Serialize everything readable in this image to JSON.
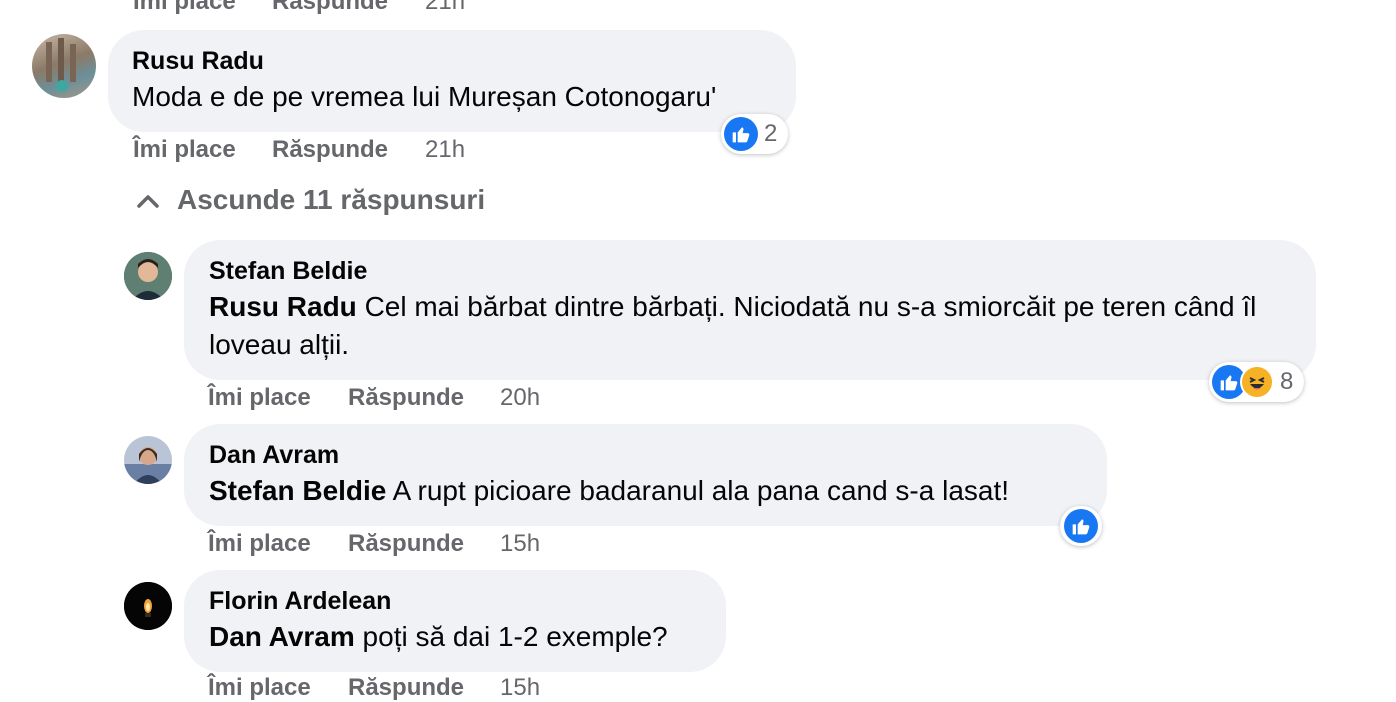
{
  "top_partial": {
    "like": "Îmi place",
    "reply": "Răspunde",
    "time": "21h"
  },
  "comments": [
    {
      "author": "Rusu Radu",
      "mention": "",
      "text": "Moda e de pe vremea lui Mureșan Cotonogaru'",
      "like": "Îmi place",
      "reply": "Răspunde",
      "time": "21h",
      "reaction_count": "2"
    },
    {
      "author": "Stefan Beldie",
      "mention": "Rusu Radu",
      "text": "Cel mai bărbat dintre bărbați. Niciodată nu s-a smiorcăit pe teren când îl loveau alții.",
      "like": "Îmi place",
      "reply": "Răspunde",
      "time": "20h",
      "reaction_count": "8"
    },
    {
      "author": "Dan Avram",
      "mention": "Stefan Beldie",
      "text": "A rupt picioare badaranul ala pana cand s-a lasat!",
      "like": "Îmi place",
      "reply": "Răspunde",
      "time": "15h",
      "reaction_count": ""
    },
    {
      "author": "Florin Ardelean",
      "mention": "Dan Avram",
      "text": "poți să dai 1-2 exemple?",
      "like": "Îmi place",
      "reply": "Răspunde",
      "time": "15h",
      "reaction_count": ""
    }
  ],
  "hide_replies": "Ascunde 11 răspunsuri",
  "icons": {
    "like": "like-icon",
    "haha": "haha-icon",
    "collapse": "chevron-up-icon"
  },
  "colors": {
    "bubble": "#f0f2f5",
    "secondary_text": "#65676b",
    "like_blue": "#1877f2"
  }
}
